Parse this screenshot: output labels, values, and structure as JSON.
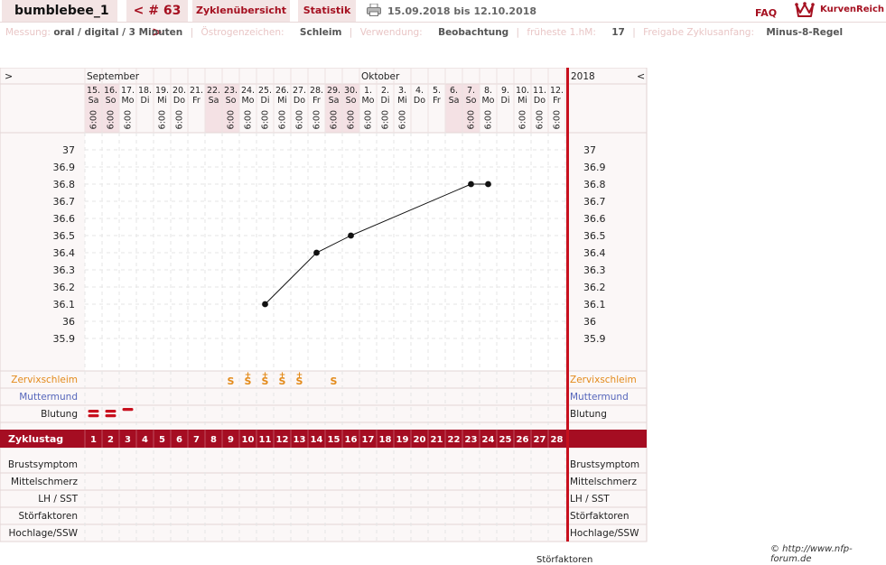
{
  "header": {
    "username": "bumblebee_1",
    "cycle_nav": "< # 63 >",
    "tabs": [
      "Zyklenübersicht",
      "Statistik"
    ],
    "date_range": "15.09.2018 bis 12.10.2018",
    "faq": "FAQ",
    "brand": "KurvenReich"
  },
  "info": [
    {
      "label": "Messung:",
      "value": "oral / digital / 3 Minuten"
    },
    {
      "label": "Östrogenzeichen:",
      "value": "Schleim"
    },
    {
      "label": "Verwendung:",
      "value": "Beobachtung"
    },
    {
      "label": "früheste 1.hM:",
      "value": "17"
    },
    {
      "label": "Freigabe Zyklusanfang:",
      "value": "Minus-8-Regel"
    }
  ],
  "chart": {
    "nav_prev": ">",
    "nav_next": "<",
    "months": [
      {
        "label": "September",
        "start_index": 0
      },
      {
        "label": "Oktober",
        "start_index": 16
      }
    ],
    "year": "2018",
    "days": [
      {
        "d": "15.",
        "w": "Sa",
        "t": "6:00",
        "we": true
      },
      {
        "d": "16.",
        "w": "So",
        "t": "6:00",
        "we": true
      },
      {
        "d": "17.",
        "w": "Mo",
        "t": "6:00",
        "we": false
      },
      {
        "d": "18.",
        "w": "Di",
        "t": "",
        "we": false
      },
      {
        "d": "19.",
        "w": "Mi",
        "t": "6:00",
        "we": false
      },
      {
        "d": "20.",
        "w": "Do",
        "t": "6:00",
        "we": false
      },
      {
        "d": "21.",
        "w": "Fr",
        "t": "",
        "we": false
      },
      {
        "d": "22.",
        "w": "Sa",
        "t": "",
        "we": true
      },
      {
        "d": "23.",
        "w": "So",
        "t": "6:00",
        "we": true
      },
      {
        "d": "24.",
        "w": "Mo",
        "t": "6:00",
        "we": false
      },
      {
        "d": "25.",
        "w": "Di",
        "t": "6:00",
        "we": false
      },
      {
        "d": "26.",
        "w": "Mi",
        "t": "6:00",
        "we": false
      },
      {
        "d": "27.",
        "w": "Do",
        "t": "6:00",
        "we": false
      },
      {
        "d": "28.",
        "w": "Fr",
        "t": "6:00",
        "we": false
      },
      {
        "d": "29.",
        "w": "Sa",
        "t": "6:00",
        "we": true
      },
      {
        "d": "30.",
        "w": "So",
        "t": "6:00",
        "we": true
      },
      {
        "d": "1.",
        "w": "Mo",
        "t": "6:00",
        "we": false
      },
      {
        "d": "2.",
        "w": "Di",
        "t": "6:00",
        "we": false
      },
      {
        "d": "3.",
        "w": "Mi",
        "t": "6:00",
        "we": false
      },
      {
        "d": "4.",
        "w": "Do",
        "t": "",
        "we": false
      },
      {
        "d": "5.",
        "w": "Fr",
        "t": "",
        "we": false
      },
      {
        "d": "6.",
        "w": "Sa",
        "t": "",
        "we": true
      },
      {
        "d": "7.",
        "w": "So",
        "t": "6:00",
        "we": true
      },
      {
        "d": "8.",
        "w": "Mo",
        "t": "6:00",
        "we": false
      },
      {
        "d": "9.",
        "w": "Di",
        "t": "",
        "we": false
      },
      {
        "d": "10.",
        "w": "Mi",
        "t": "6:00",
        "we": false
      },
      {
        "d": "11.",
        "w": "Do",
        "t": "6:00",
        "we": false
      },
      {
        "d": "12.",
        "w": "Fr",
        "t": "6:00",
        "we": false
      }
    ],
    "y_ticks": [
      "37",
      "36.9",
      "36.8",
      "36.7",
      "36.6",
      "36.5",
      "36.4",
      "36.3",
      "36.2",
      "36.1",
      "36",
      "35.9"
    ],
    "y_max": 37,
    "y_step": 0.1,
    "temperatures": [
      {
        "cycle_day": 11,
        "value": 36.1
      },
      {
        "cycle_day": 14,
        "value": 36.4
      },
      {
        "cycle_day": 16,
        "value": 36.5
      },
      {
        "cycle_day": 23,
        "value": 36.8
      },
      {
        "cycle_day": 24,
        "value": 36.8
      }
    ],
    "rows_top": [
      {
        "label": "Zervixschleim",
        "color": "#e38a1a"
      },
      {
        "label": "Muttermund",
        "color": "#5566bb"
      },
      {
        "label": "Blutung",
        "color": "#222222"
      }
    ],
    "cervix": [
      {
        "cycle_day": 9,
        "symbol": "S",
        "plus": false
      },
      {
        "cycle_day": 10,
        "symbol": "S",
        "plus": true
      },
      {
        "cycle_day": 11,
        "symbol": "S",
        "plus": true
      },
      {
        "cycle_day": 12,
        "symbol": "S",
        "plus": true
      },
      {
        "cycle_day": 13,
        "symbol": "S",
        "plus": true
      },
      {
        "cycle_day": 15,
        "symbol": "S",
        "plus": false
      }
    ],
    "bleeding": [
      {
        "cycle_day": 1,
        "bars": 2
      },
      {
        "cycle_day": 2,
        "bars": 2
      },
      {
        "cycle_day": 3,
        "bars": 1
      }
    ],
    "zyklustag_label": "Zyklustag",
    "cycle_days": [
      "1",
      "2",
      "3",
      "4",
      "5",
      "6",
      "7",
      "8",
      "9",
      "10",
      "11",
      "12",
      "13",
      "14",
      "15",
      "16",
      "17",
      "18",
      "19",
      "20",
      "21",
      "22",
      "23",
      "24",
      "25",
      "26",
      "27",
      "28"
    ],
    "rows_bottom": [
      "Brustsymptom",
      "Mittelschmerz",
      "LH / SST",
      "Störfaktoren",
      "Hochlage/SSW"
    ],
    "accent": "#a50d22",
    "weekend_bg": "#f4e1e4"
  },
  "footer": {
    "copyright": "© http://www.nfp-forum.de",
    "cutoff_text": "Störfaktoren"
  }
}
